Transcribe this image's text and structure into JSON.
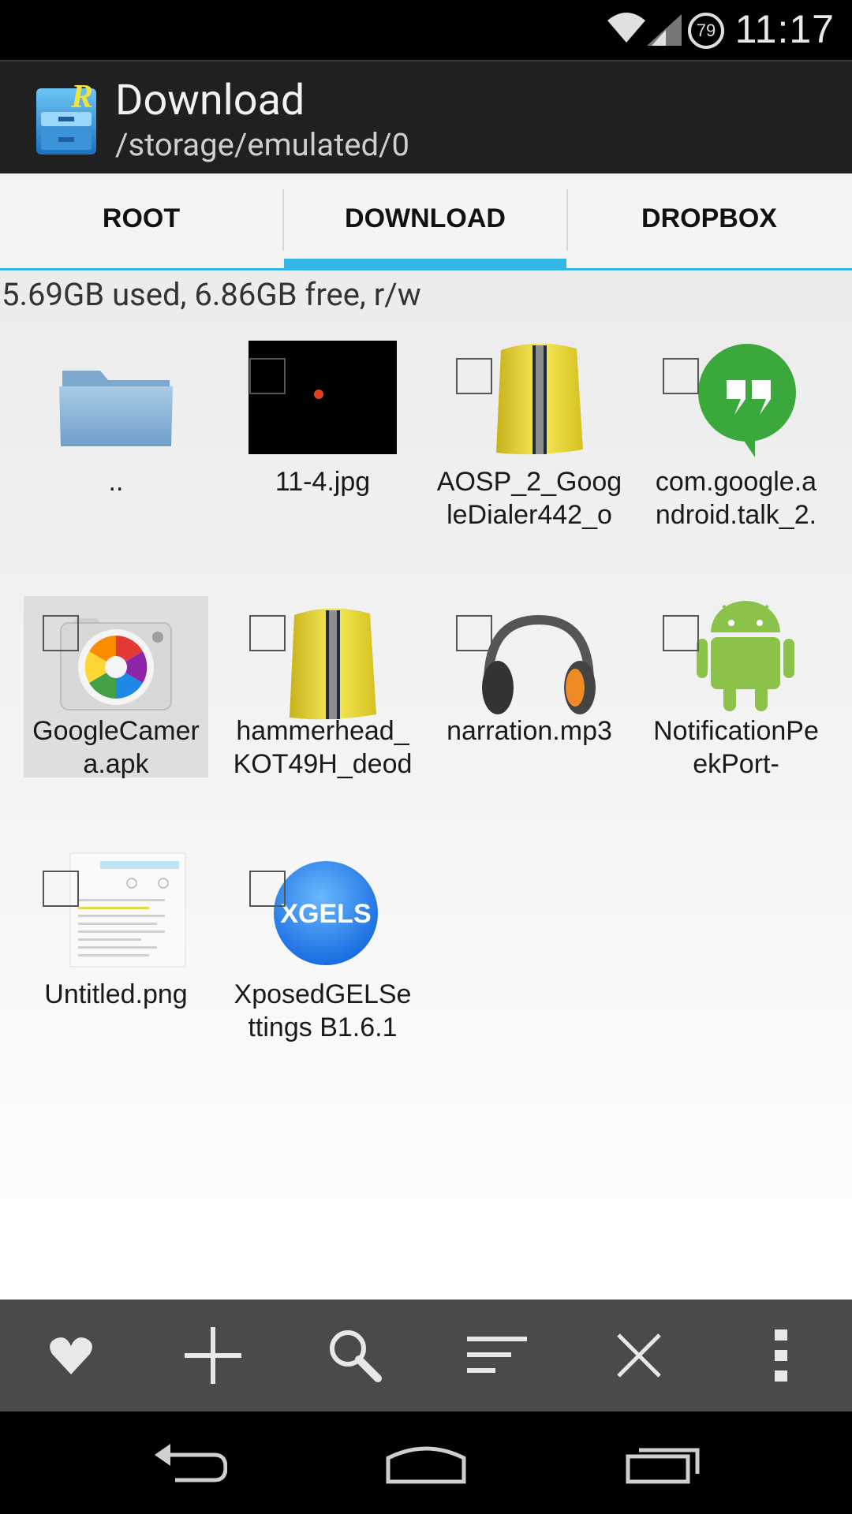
{
  "status_bar": {
    "time": "11:17",
    "battery": "79"
  },
  "action_bar": {
    "title": "Download",
    "subtitle": "/storage/emulated/0"
  },
  "tabs": [
    {
      "label": "ROOT",
      "active": false
    },
    {
      "label": "DOWNLOAD",
      "active": true
    },
    {
      "label": "DROPBOX",
      "active": false
    }
  ],
  "storage_info": "5.69GB used, 6.86GB free, r/w",
  "files": [
    {
      "name_line1": "..",
      "name_line2": "",
      "icon": "folder-icon"
    },
    {
      "name_line1": "11-4.jpg",
      "name_line2": "",
      "icon": "image-thumbnail"
    },
    {
      "name_line1": "AOSP_2_Goog",
      "name_line2": "leDialer442_o",
      "icon": "zip-icon"
    },
    {
      "name_line1": "com.google.a",
      "name_line2": "ndroid.talk_2.",
      "icon": "hangouts-icon"
    },
    {
      "name_line1": "GoogleCamer",
      "name_line2": "a.apk",
      "icon": "camera-icon"
    },
    {
      "name_line1": "hammerhead_",
      "name_line2": "KOT49H_deod",
      "icon": "zip-icon"
    },
    {
      "name_line1": "narration.mp3",
      "name_line2": "",
      "icon": "headphones-icon"
    },
    {
      "name_line1": "NotificationPe",
      "name_line2": "ekPort-",
      "icon": "android-icon"
    },
    {
      "name_line1": "Untitled.png",
      "name_line2": "",
      "icon": "screenshot-thumbnail"
    },
    {
      "name_line1": "XposedGELSe",
      "name_line2": "ttings B1.6.1",
      "icon": "xgels-icon"
    }
  ],
  "xgels_label": "XGELS",
  "app_icon_letter": "R",
  "toolbar": [
    "heart-icon",
    "plus-icon",
    "search-icon",
    "sort-icon",
    "close-icon",
    "overflow-icon"
  ],
  "colors": {
    "accent": "#33b5e5",
    "actionbar": "#202020",
    "toolbar": "#4a4a4a"
  }
}
